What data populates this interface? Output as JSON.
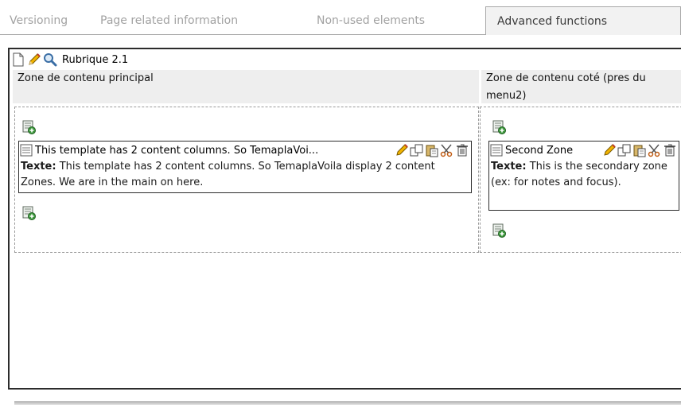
{
  "tabs": [
    {
      "label": "Versioning",
      "active": false
    },
    {
      "label": "Page related information",
      "active": false
    },
    {
      "label": "Non-used elements",
      "active": false
    },
    {
      "label": "Advanced functions",
      "active": true
    }
  ],
  "page": {
    "title": "Rubrique 2.1",
    "icons": [
      "page-icon",
      "edit-pencil-icon",
      "view-magnifier-icon"
    ]
  },
  "columns": {
    "main": {
      "header": "Zone de contenu principal",
      "element": {
        "title": "This template has 2 content columns. So TemaplaVoi...",
        "field_label": "Texte:",
        "field_text": " This template has 2 content columns. So TemaplaVoila display 2 content Zones. We are in the main on here."
      }
    },
    "side": {
      "header": "Zone de contenu coté (pres du menu2)",
      "element": {
        "title": "Second Zone",
        "field_label": "Texte:",
        "field_text": " This is the secondary zone (ex: for notes and focus)."
      }
    }
  },
  "tool_icons": [
    "edit-pencil-icon",
    "copy-icon",
    "paste-icon",
    "cut-scissors-icon",
    "delete-trash-icon"
  ],
  "colors": {
    "frame_border": "#2c2c2c",
    "header_bg": "#eeeeee",
    "tab_inactive": "#a2a2a2",
    "tab_active_bg": "#f2f2f2"
  }
}
